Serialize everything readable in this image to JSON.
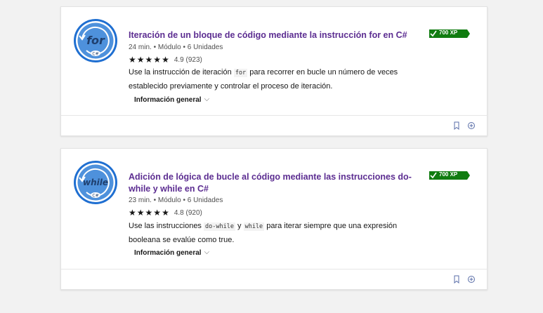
{
  "colors": {
    "title": "#5c2d91",
    "badge_blue": "#4e91dc",
    "badge_ring": "#1f6fd1",
    "xp_green": "#107c10",
    "footer_icon": "#5a6ea8"
  },
  "modules": [
    {
      "icon_text": "for",
      "icon_sub": "C#",
      "title": "Iteración de un bloque de código mediante la instrucción for en C#",
      "duration": "24 min.",
      "type": "Módulo",
      "units": "6 Unidades",
      "rating_value": 4.9,
      "rating_text": "4.9 (923)",
      "summary_pre": "Use la instrucción de iteración",
      "summary_code1": "for",
      "summary_mid": "para recorrer en bucle un número de veces establecido previamente y controlar el proceso de iteración.",
      "summary_code2": "",
      "summary_post": "",
      "overview_label": "Información general",
      "xp": "700 XP"
    },
    {
      "icon_text": "while",
      "icon_sub": "C#",
      "title": "Adición de lógica de bucle al código mediante las instrucciones do-while y while en C#",
      "duration": "23 min.",
      "type": "Módulo",
      "units": "6 Unidades",
      "rating_value": 4.8,
      "rating_text": "4.8 (920)",
      "summary_pre": "Use las instrucciones",
      "summary_code1": "do-while",
      "summary_mid": "y",
      "summary_code2": "while",
      "summary_post": "para iterar siempre que una expresión booleana se evalúe como true.",
      "overview_label": "Información general",
      "xp": "700 XP"
    }
  ]
}
